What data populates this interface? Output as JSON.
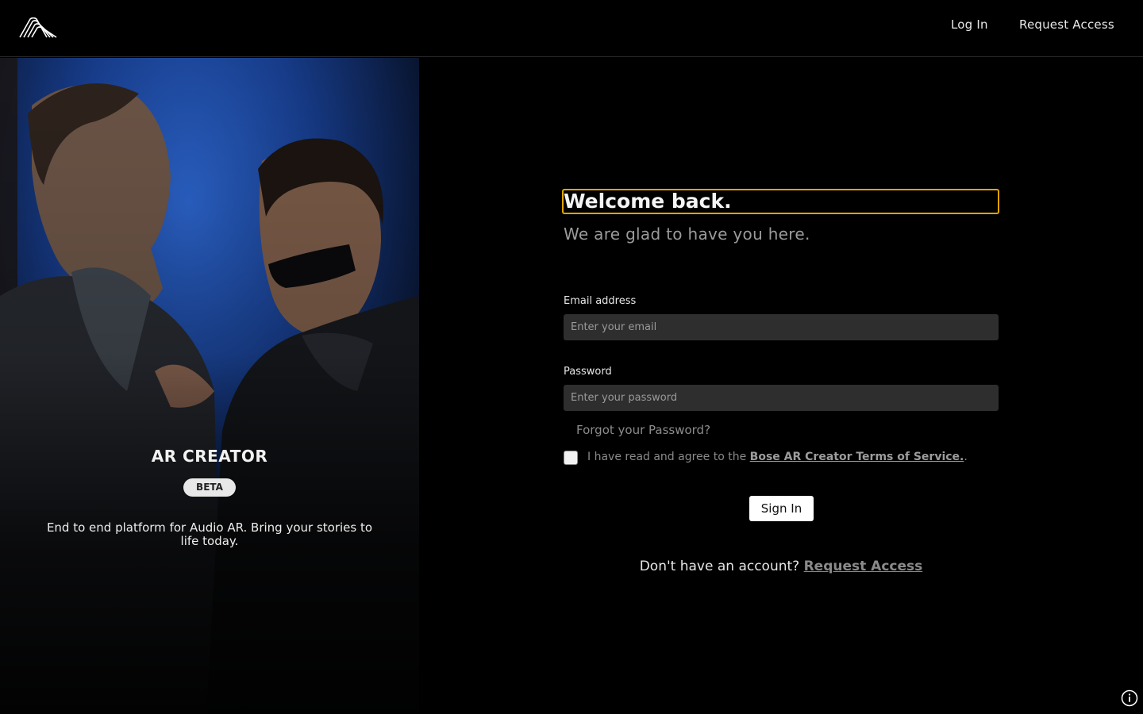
{
  "header": {
    "logo_icon": "bose-ar-logo-icon",
    "nav": {
      "login_label": "Log In",
      "request_label": "Request Access"
    }
  },
  "hero": {
    "title": "AR CREATOR",
    "badge": "BETA",
    "description": "End to end platform for Audio AR. Bring your stories to life today."
  },
  "form": {
    "heading": "Welcome back.",
    "subtitle": "We are glad to have you here.",
    "email": {
      "label": "Email address",
      "placeholder": "Enter your email",
      "value": ""
    },
    "password": {
      "label": "Password",
      "placeholder": "Enter your password",
      "value": ""
    },
    "forgot_label": "Forgot your Password?",
    "terms": {
      "checked": false,
      "prefix": "I have read and agree to the ",
      "link": "Bose AR Creator Terms of Service.",
      "suffix": "."
    },
    "submit_label": "Sign In",
    "signup": {
      "prompt": "Don't have an account? ",
      "link": "Request Access"
    }
  },
  "colors": {
    "background": "#000000",
    "focus_outline": "#e3a400",
    "input_bg": "#2e2e2e"
  },
  "icons": {
    "info": "info-icon"
  }
}
